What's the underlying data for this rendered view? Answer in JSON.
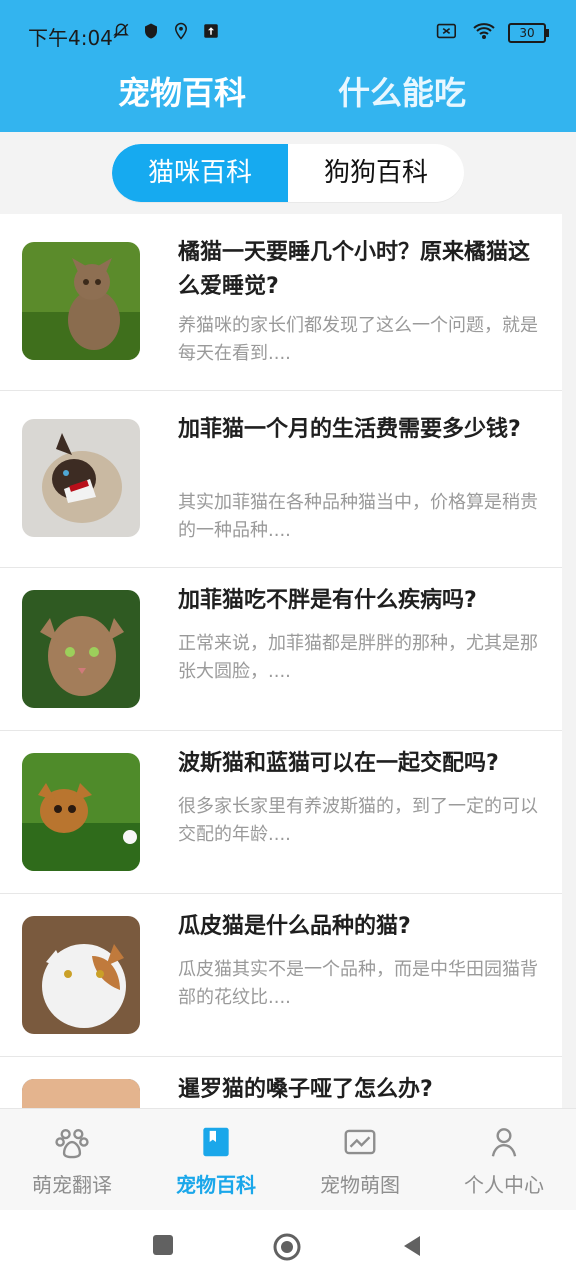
{
  "status": {
    "time": "下午4:04",
    "battery": "30"
  },
  "header": {
    "tabs": [
      {
        "label": "宠物百科"
      },
      {
        "label": "什么能吃"
      }
    ]
  },
  "segment": {
    "left": "猫咪百科",
    "right": "狗狗百科"
  },
  "articles": [
    {
      "title": "橘猫一天要睡几个小时？原来橘猫这么爱睡觉?",
      "desc": "养猫咪的家长们都发现了这么一个问题，就是每天在看到...."
    },
    {
      "title": "加菲猫一个月的生活费需要多少钱?",
      "desc": "其实加菲猫在各种品种猫当中，价格算是稍贵的一种品种...."
    },
    {
      "title": "加菲猫吃不胖是有什么疾病吗?",
      "desc": "正常来说，加菲猫都是胖胖的那种，尤其是那张大圆脸，...."
    },
    {
      "title": "波斯猫和蓝猫可以在一起交配吗?",
      "desc": "很多家长家里有养波斯猫的，到了一定的可以交配的年龄...."
    },
    {
      "title": "瓜皮猫是什么品种的猫?",
      "desc": "瓜皮猫其实不是一个品种，而是中华田园猫背部的花纹比...."
    },
    {
      "title": "暹罗猫的嗓子哑了怎么办?",
      "desc": ""
    }
  ],
  "bottom_nav": [
    {
      "label": "萌宠翻译",
      "icon": "paw-icon"
    },
    {
      "label": "宠物百科",
      "icon": "bookmark-icon",
      "active": true
    },
    {
      "label": "宠物萌图",
      "icon": "image-icon"
    },
    {
      "label": "个人中心",
      "icon": "person-icon"
    }
  ],
  "colors": {
    "header_blue": "#33b4ef",
    "segment_active": "#16aaf0",
    "nav_active": "#1aa7ea"
  }
}
